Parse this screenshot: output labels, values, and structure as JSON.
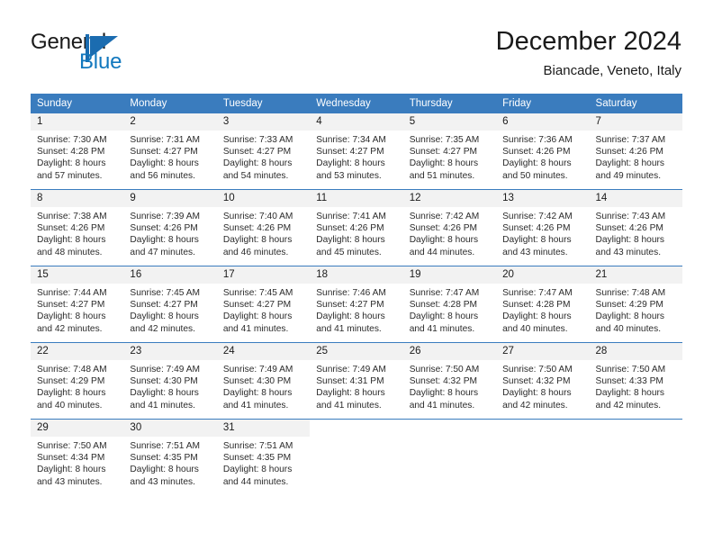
{
  "brand": {
    "name_part1": "General",
    "name_part2": "Blue"
  },
  "header": {
    "month_title": "December 2024",
    "location": "Biancade, Veneto, Italy"
  },
  "colors": {
    "header_blue": "#3a7cbe",
    "brand_blue": "#1278be",
    "daynum_bg": "#f2f2f2",
    "text": "#1a1a1a"
  },
  "weekdays": [
    "Sunday",
    "Monday",
    "Tuesday",
    "Wednesday",
    "Thursday",
    "Friday",
    "Saturday"
  ],
  "weeks": [
    [
      {
        "day": "1",
        "sunrise": "Sunrise: 7:30 AM",
        "sunset": "Sunset: 4:28 PM",
        "daylight1": "Daylight: 8 hours",
        "daylight2": "and 57 minutes."
      },
      {
        "day": "2",
        "sunrise": "Sunrise: 7:31 AM",
        "sunset": "Sunset: 4:27 PM",
        "daylight1": "Daylight: 8 hours",
        "daylight2": "and 56 minutes."
      },
      {
        "day": "3",
        "sunrise": "Sunrise: 7:33 AM",
        "sunset": "Sunset: 4:27 PM",
        "daylight1": "Daylight: 8 hours",
        "daylight2": "and 54 minutes."
      },
      {
        "day": "4",
        "sunrise": "Sunrise: 7:34 AM",
        "sunset": "Sunset: 4:27 PM",
        "daylight1": "Daylight: 8 hours",
        "daylight2": "and 53 minutes."
      },
      {
        "day": "5",
        "sunrise": "Sunrise: 7:35 AM",
        "sunset": "Sunset: 4:27 PM",
        "daylight1": "Daylight: 8 hours",
        "daylight2": "and 51 minutes."
      },
      {
        "day": "6",
        "sunrise": "Sunrise: 7:36 AM",
        "sunset": "Sunset: 4:26 PM",
        "daylight1": "Daylight: 8 hours",
        "daylight2": "and 50 minutes."
      },
      {
        "day": "7",
        "sunrise": "Sunrise: 7:37 AM",
        "sunset": "Sunset: 4:26 PM",
        "daylight1": "Daylight: 8 hours",
        "daylight2": "and 49 minutes."
      }
    ],
    [
      {
        "day": "8",
        "sunrise": "Sunrise: 7:38 AM",
        "sunset": "Sunset: 4:26 PM",
        "daylight1": "Daylight: 8 hours",
        "daylight2": "and 48 minutes."
      },
      {
        "day": "9",
        "sunrise": "Sunrise: 7:39 AM",
        "sunset": "Sunset: 4:26 PM",
        "daylight1": "Daylight: 8 hours",
        "daylight2": "and 47 minutes."
      },
      {
        "day": "10",
        "sunrise": "Sunrise: 7:40 AM",
        "sunset": "Sunset: 4:26 PM",
        "daylight1": "Daylight: 8 hours",
        "daylight2": "and 46 minutes."
      },
      {
        "day": "11",
        "sunrise": "Sunrise: 7:41 AM",
        "sunset": "Sunset: 4:26 PM",
        "daylight1": "Daylight: 8 hours",
        "daylight2": "and 45 minutes."
      },
      {
        "day": "12",
        "sunrise": "Sunrise: 7:42 AM",
        "sunset": "Sunset: 4:26 PM",
        "daylight1": "Daylight: 8 hours",
        "daylight2": "and 44 minutes."
      },
      {
        "day": "13",
        "sunrise": "Sunrise: 7:42 AM",
        "sunset": "Sunset: 4:26 PM",
        "daylight1": "Daylight: 8 hours",
        "daylight2": "and 43 minutes."
      },
      {
        "day": "14",
        "sunrise": "Sunrise: 7:43 AM",
        "sunset": "Sunset: 4:26 PM",
        "daylight1": "Daylight: 8 hours",
        "daylight2": "and 43 minutes."
      }
    ],
    [
      {
        "day": "15",
        "sunrise": "Sunrise: 7:44 AM",
        "sunset": "Sunset: 4:27 PM",
        "daylight1": "Daylight: 8 hours",
        "daylight2": "and 42 minutes."
      },
      {
        "day": "16",
        "sunrise": "Sunrise: 7:45 AM",
        "sunset": "Sunset: 4:27 PM",
        "daylight1": "Daylight: 8 hours",
        "daylight2": "and 42 minutes."
      },
      {
        "day": "17",
        "sunrise": "Sunrise: 7:45 AM",
        "sunset": "Sunset: 4:27 PM",
        "daylight1": "Daylight: 8 hours",
        "daylight2": "and 41 minutes."
      },
      {
        "day": "18",
        "sunrise": "Sunrise: 7:46 AM",
        "sunset": "Sunset: 4:27 PM",
        "daylight1": "Daylight: 8 hours",
        "daylight2": "and 41 minutes."
      },
      {
        "day": "19",
        "sunrise": "Sunrise: 7:47 AM",
        "sunset": "Sunset: 4:28 PM",
        "daylight1": "Daylight: 8 hours",
        "daylight2": "and 41 minutes."
      },
      {
        "day": "20",
        "sunrise": "Sunrise: 7:47 AM",
        "sunset": "Sunset: 4:28 PM",
        "daylight1": "Daylight: 8 hours",
        "daylight2": "and 40 minutes."
      },
      {
        "day": "21",
        "sunrise": "Sunrise: 7:48 AM",
        "sunset": "Sunset: 4:29 PM",
        "daylight1": "Daylight: 8 hours",
        "daylight2": "and 40 minutes."
      }
    ],
    [
      {
        "day": "22",
        "sunrise": "Sunrise: 7:48 AM",
        "sunset": "Sunset: 4:29 PM",
        "daylight1": "Daylight: 8 hours",
        "daylight2": "and 40 minutes."
      },
      {
        "day": "23",
        "sunrise": "Sunrise: 7:49 AM",
        "sunset": "Sunset: 4:30 PM",
        "daylight1": "Daylight: 8 hours",
        "daylight2": "and 41 minutes."
      },
      {
        "day": "24",
        "sunrise": "Sunrise: 7:49 AM",
        "sunset": "Sunset: 4:30 PM",
        "daylight1": "Daylight: 8 hours",
        "daylight2": "and 41 minutes."
      },
      {
        "day": "25",
        "sunrise": "Sunrise: 7:49 AM",
        "sunset": "Sunset: 4:31 PM",
        "daylight1": "Daylight: 8 hours",
        "daylight2": "and 41 minutes."
      },
      {
        "day": "26",
        "sunrise": "Sunrise: 7:50 AM",
        "sunset": "Sunset: 4:32 PM",
        "daylight1": "Daylight: 8 hours",
        "daylight2": "and 41 minutes."
      },
      {
        "day": "27",
        "sunrise": "Sunrise: 7:50 AM",
        "sunset": "Sunset: 4:32 PM",
        "daylight1": "Daylight: 8 hours",
        "daylight2": "and 42 minutes."
      },
      {
        "day": "28",
        "sunrise": "Sunrise: 7:50 AM",
        "sunset": "Sunset: 4:33 PM",
        "daylight1": "Daylight: 8 hours",
        "daylight2": "and 42 minutes."
      }
    ],
    [
      {
        "day": "29",
        "sunrise": "Sunrise: 7:50 AM",
        "sunset": "Sunset: 4:34 PM",
        "daylight1": "Daylight: 8 hours",
        "daylight2": "and 43 minutes."
      },
      {
        "day": "30",
        "sunrise": "Sunrise: 7:51 AM",
        "sunset": "Sunset: 4:35 PM",
        "daylight1": "Daylight: 8 hours",
        "daylight2": "and 43 minutes."
      },
      {
        "day": "31",
        "sunrise": "Sunrise: 7:51 AM",
        "sunset": "Sunset: 4:35 PM",
        "daylight1": "Daylight: 8 hours",
        "daylight2": "and 44 minutes."
      },
      {
        "day": "",
        "sunrise": "",
        "sunset": "",
        "daylight1": "",
        "daylight2": ""
      },
      {
        "day": "",
        "sunrise": "",
        "sunset": "",
        "daylight1": "",
        "daylight2": ""
      },
      {
        "day": "",
        "sunrise": "",
        "sunset": "",
        "daylight1": "",
        "daylight2": ""
      },
      {
        "day": "",
        "sunrise": "",
        "sunset": "",
        "daylight1": "",
        "daylight2": ""
      }
    ]
  ]
}
